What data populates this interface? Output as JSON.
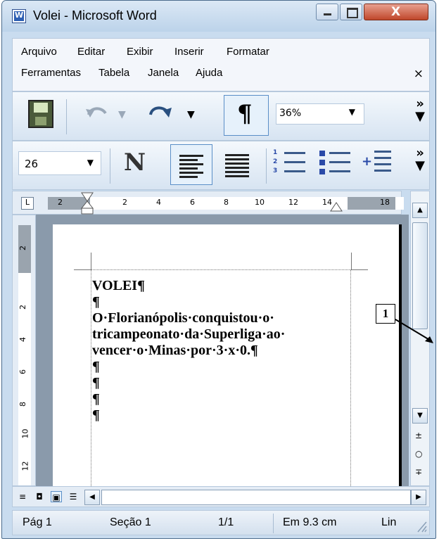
{
  "window": {
    "title": "Volei - Microsoft Word",
    "app_icon_letter": "W",
    "close_glyph": "X"
  },
  "menu": {
    "row1": [
      "Arquivo",
      "Editar",
      "Exibir",
      "Inserir",
      "Formatar"
    ],
    "row2": [
      "Ferramentas",
      "Tabela",
      "Janela",
      "Ajuda"
    ],
    "close_glyph": "×"
  },
  "toolbar1": {
    "icons": [
      "save-icon",
      "undo-icon",
      "redo-icon",
      "pilcrow-icon"
    ],
    "pilcrow_label": "¶",
    "zoom_value": "36%",
    "overflow_glyph": "»"
  },
  "toolbar2": {
    "font_size_value": "26",
    "style_label": "N",
    "icons": [
      "align-left-icon",
      "align-justify-icon",
      "numbered-list-icon",
      "bulleted-list-icon",
      "increase-indent-icon"
    ],
    "overflow_glyph": "»"
  },
  "ruler": {
    "tab_selector": "L",
    "h_numbers": [
      "2",
      "2",
      "4",
      "6",
      "8",
      "10",
      "12",
      "14",
      "18"
    ],
    "v_numbers": [
      "2",
      "2",
      "4",
      "6",
      "8",
      "10",
      "12"
    ]
  },
  "document": {
    "lines": [
      "VOLEI¶",
      "¶",
      "O·Florianópolis·conquistou·o·",
      "tricampeonato·da·Superliga·ao·",
      "vencer·o·Minas·por·3·x·0.¶",
      "¶",
      "¶",
      "¶",
      "¶"
    ]
  },
  "status": {
    "page": "Pág 1",
    "section": "Seção 1",
    "pages": "1/1",
    "position": "Em 9.3 cm",
    "line": "Lin"
  },
  "annotation": {
    "callout_label": "1"
  }
}
